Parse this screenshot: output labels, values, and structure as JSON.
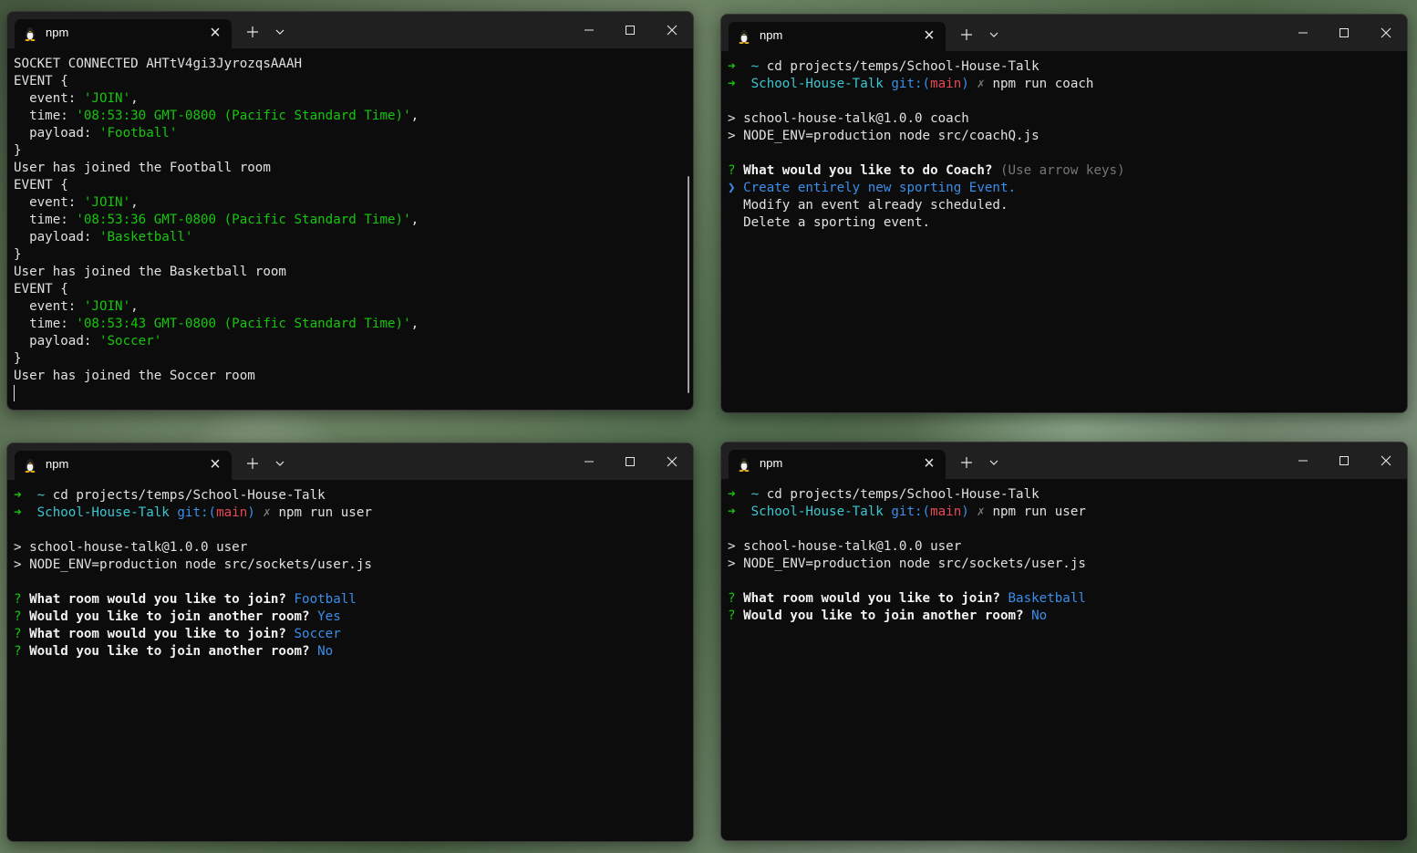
{
  "windows": [
    {
      "tab_title": "npm",
      "lines": [
        [
          {
            "t": "SOCKET CONNECTED AHTtV4gi3JyrozqsAAAH"
          }
        ],
        [
          {
            "t": "EVENT {"
          }
        ],
        [
          {
            "t": "  event: "
          },
          {
            "t": "'JOIN'",
            "c": "gs"
          },
          {
            "t": ","
          }
        ],
        [
          {
            "t": "  time: "
          },
          {
            "t": "'08:53:30 GMT-0800 (Pacific Standard Time)'",
            "c": "gs"
          },
          {
            "t": ","
          }
        ],
        [
          {
            "t": "  payload: "
          },
          {
            "t": "'Football'",
            "c": "gs"
          }
        ],
        [
          {
            "t": "}"
          }
        ],
        [
          {
            "t": "User has joined the Football room"
          }
        ],
        [
          {
            "t": "EVENT {"
          }
        ],
        [
          {
            "t": "  event: "
          },
          {
            "t": "'JOIN'",
            "c": "gs"
          },
          {
            "t": ","
          }
        ],
        [
          {
            "t": "  time: "
          },
          {
            "t": "'08:53:36 GMT-0800 (Pacific Standard Time)'",
            "c": "gs"
          },
          {
            "t": ","
          }
        ],
        [
          {
            "t": "  payload: "
          },
          {
            "t": "'Basketball'",
            "c": "gs"
          }
        ],
        [
          {
            "t": "}"
          }
        ],
        [
          {
            "t": "User has joined the Basketball room"
          }
        ],
        [
          {
            "t": "EVENT {"
          }
        ],
        [
          {
            "t": "  event: "
          },
          {
            "t": "'JOIN'",
            "c": "gs"
          },
          {
            "t": ","
          }
        ],
        [
          {
            "t": "  time: "
          },
          {
            "t": "'08:53:43 GMT-0800 (Pacific Standard Time)'",
            "c": "gs"
          },
          {
            "t": ","
          }
        ],
        [
          {
            "t": "  payload: "
          },
          {
            "t": "'Soccer'",
            "c": "gs"
          }
        ],
        [
          {
            "t": "}"
          }
        ],
        [
          {
            "t": "User has joined the Soccer room"
          }
        ],
        [
          {
            "cursor": true
          }
        ]
      ]
    },
    {
      "tab_title": "npm",
      "lines": [
        [
          {
            "t": "➜  ",
            "c": "g"
          },
          {
            "t": "~ ",
            "c": "c"
          },
          {
            "t": "cd projects/temps/School-House-Talk"
          }
        ],
        [
          {
            "t": "➜  ",
            "c": "g"
          },
          {
            "t": "School-House-Talk ",
            "c": "c"
          },
          {
            "t": "git:(",
            "c": "b"
          },
          {
            "t": "main",
            "c": "r"
          },
          {
            "t": ")",
            "c": "b"
          },
          {
            "t": " ✗ ",
            "c": "dim"
          },
          {
            "t": "npm run coach"
          }
        ],
        [
          {
            "t": ""
          }
        ],
        [
          {
            "t": "> school-house-talk@1.0.0 coach"
          }
        ],
        [
          {
            "t": "> NODE_ENV=production node src/coachQ.js"
          }
        ],
        [
          {
            "t": ""
          }
        ],
        [
          {
            "t": "? ",
            "c": "g"
          },
          {
            "t": "What would you like to do Coach?",
            "c": "bold"
          },
          {
            "t": " (Use arrow keys)",
            "c": "dim"
          }
        ],
        [
          {
            "t": "❯ Create entirely new sporting Event.",
            "c": "b"
          }
        ],
        [
          {
            "t": "  Modify an event already scheduled."
          }
        ],
        [
          {
            "t": "  Delete a sporting event."
          }
        ]
      ]
    },
    {
      "tab_title": "npm",
      "lines": [
        [
          {
            "t": "➜  ",
            "c": "g"
          },
          {
            "t": "~ ",
            "c": "c"
          },
          {
            "t": "cd projects/temps/School-House-Talk"
          }
        ],
        [
          {
            "t": "➜  ",
            "c": "g"
          },
          {
            "t": "School-House-Talk ",
            "c": "c"
          },
          {
            "t": "git:(",
            "c": "b"
          },
          {
            "t": "main",
            "c": "r"
          },
          {
            "t": ")",
            "c": "b"
          },
          {
            "t": " ✗ ",
            "c": "dim"
          },
          {
            "t": "npm run user"
          }
        ],
        [
          {
            "t": ""
          }
        ],
        [
          {
            "t": "> school-house-talk@1.0.0 user"
          }
        ],
        [
          {
            "t": "> NODE_ENV=production node src/sockets/user.js"
          }
        ],
        [
          {
            "t": ""
          }
        ],
        [
          {
            "t": "? ",
            "c": "g"
          },
          {
            "t": "What room would you like to join?",
            "c": "bold"
          },
          {
            "t": " Football",
            "c": "b"
          }
        ],
        [
          {
            "t": "? ",
            "c": "g"
          },
          {
            "t": "Would you like to join another room?",
            "c": "bold"
          },
          {
            "t": " Yes",
            "c": "b"
          }
        ],
        [
          {
            "t": "? ",
            "c": "g"
          },
          {
            "t": "What room would you like to join?",
            "c": "bold"
          },
          {
            "t": " Soccer",
            "c": "b"
          }
        ],
        [
          {
            "t": "? ",
            "c": "g"
          },
          {
            "t": "Would you like to join another room?",
            "c": "bold"
          },
          {
            "t": " No",
            "c": "b"
          }
        ]
      ]
    },
    {
      "tab_title": "npm",
      "lines": [
        [
          {
            "t": "➜  ",
            "c": "g"
          },
          {
            "t": "~ ",
            "c": "c"
          },
          {
            "t": "cd projects/temps/School-House-Talk"
          }
        ],
        [
          {
            "t": "➜  ",
            "c": "g"
          },
          {
            "t": "School-House-Talk ",
            "c": "c"
          },
          {
            "t": "git:(",
            "c": "b"
          },
          {
            "t": "main",
            "c": "r"
          },
          {
            "t": ")",
            "c": "b"
          },
          {
            "t": " ✗ ",
            "c": "dim"
          },
          {
            "t": "npm run user"
          }
        ],
        [
          {
            "t": ""
          }
        ],
        [
          {
            "t": "> school-house-talk@1.0.0 user"
          }
        ],
        [
          {
            "t": "> NODE_ENV=production node src/sockets/user.js"
          }
        ],
        [
          {
            "t": ""
          }
        ],
        [
          {
            "t": "? ",
            "c": "g"
          },
          {
            "t": "What room would you like to join?",
            "c": "bold"
          },
          {
            "t": " Basketball",
            "c": "b"
          }
        ],
        [
          {
            "t": "? ",
            "c": "g"
          },
          {
            "t": "Would you like to join another room?",
            "c": "bold"
          },
          {
            "t": " No",
            "c": "b"
          }
        ]
      ]
    }
  ]
}
